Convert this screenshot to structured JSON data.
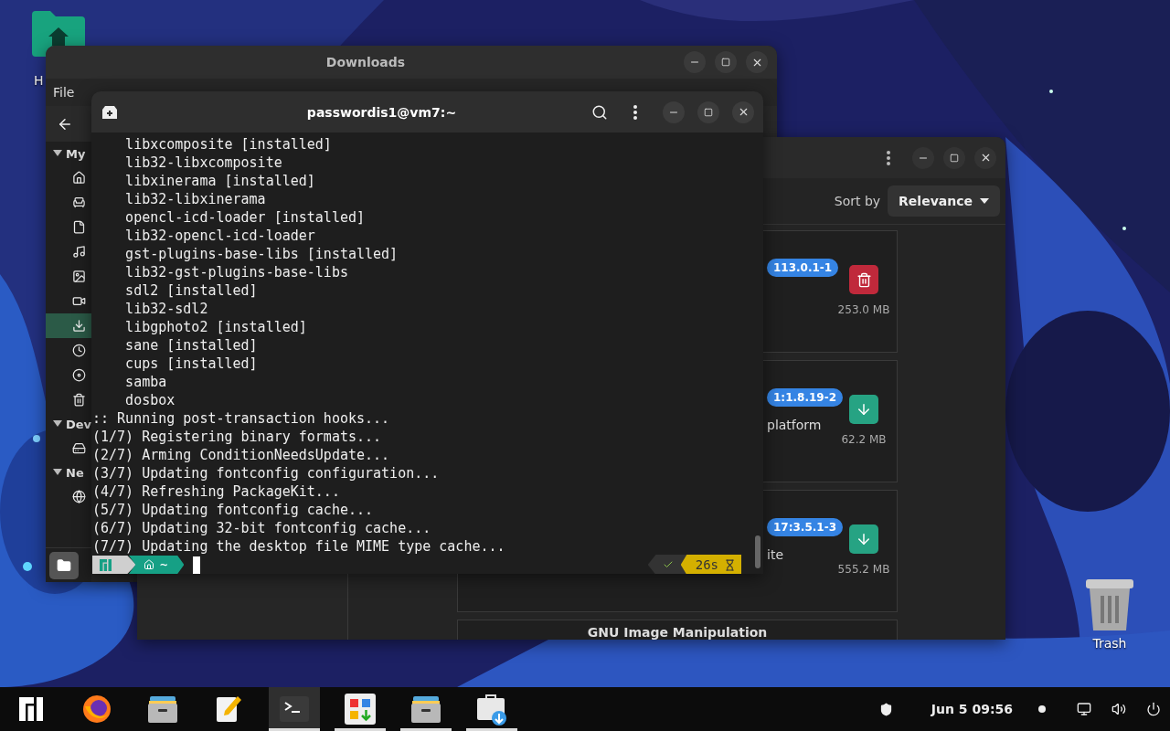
{
  "desktop": {
    "icons": [
      {
        "label": "H"
      },
      {
        "label": "Trash"
      }
    ]
  },
  "files_window": {
    "title": "Downloads",
    "menu": [
      "File"
    ],
    "sidebar": [
      {
        "label": "My",
        "expanded": true,
        "items": [
          {
            "selected": false
          },
          {
            "selected": false
          },
          {
            "selected": false
          },
          {
            "selected": false
          },
          {
            "selected": false
          },
          {
            "selected": false
          },
          {
            "selected": true
          },
          {
            "selected": false
          },
          {
            "selected": false
          },
          {
            "selected": false
          }
        ]
      },
      {
        "label": "Dev",
        "expanded": true,
        "items": [
          {
            "selected": false
          }
        ]
      },
      {
        "label": "Ne",
        "expanded": true,
        "items": [
          {
            "selected": false
          }
        ]
      }
    ]
  },
  "software_window": {
    "sort_label": "Sort by",
    "sort_value": "Relevance",
    "apps": [
      {
        "version": "113.0.1-1",
        "kind": "remove",
        "size": "253.0 MB"
      },
      {
        "version": "1:1.8.19-2",
        "name": "platform",
        "kind": "install",
        "size": "62.2 MB"
      },
      {
        "version": "17:3.5.1-3",
        "name": "ite",
        "kind": "install",
        "size": "555.2 MB"
      },
      {
        "name": "GNU Image Manipulation"
      }
    ]
  },
  "terminal": {
    "title": "passwordis1@vm7:~",
    "lines": [
      "    libxcomposite [installed]",
      "    lib32-libxcomposite",
      "    libxinerama [installed]",
      "    lib32-libxinerama",
      "    opencl-icd-loader [installed]",
      "    lib32-opencl-icd-loader",
      "    gst-plugins-base-libs [installed]",
      "    lib32-gst-plugins-base-libs",
      "    sdl2 [installed]",
      "    lib32-sdl2",
      "    libgphoto2 [installed]",
      "    sane [installed]",
      "    cups [installed]",
      "    samba",
      "    dosbox",
      ":: Running post-transaction hooks...",
      "(1/7) Registering binary formats...",
      "(2/7) Arming ConditionNeedsUpdate...",
      "(3/7) Updating fontconfig configuration...",
      "(4/7) Refreshing PackageKit...",
      "(5/7) Updating fontconfig cache...",
      "(6/7) Updating 32-bit fontconfig cache...",
      "(7/7) Updating the desktop file MIME type cache..."
    ],
    "prompt": {
      "path": "~",
      "success": true,
      "duration": "26s"
    }
  },
  "taskbar": {
    "apps": [
      {
        "active": false,
        "running": false
      },
      {
        "active": false,
        "running": false
      },
      {
        "active": false,
        "running": false
      },
      {
        "active": false,
        "running": false
      },
      {
        "active": true,
        "running": true
      },
      {
        "active": false,
        "running": true
      },
      {
        "active": false,
        "running": true
      },
      {
        "active": false,
        "running": true
      }
    ],
    "clock": "Jun 5 09:56"
  }
}
